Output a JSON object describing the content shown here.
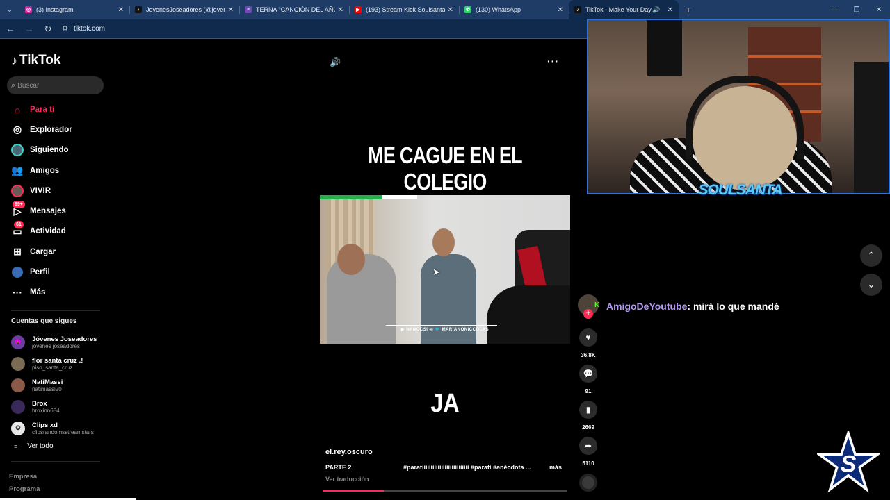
{
  "browser": {
    "tabs": [
      {
        "title": "(3) Instagram",
        "icon": "instagram-icon",
        "color": "#d6249f"
      },
      {
        "title": "JovenesJoseadores (@jovenesjo",
        "icon": "tiktok-icon",
        "color": "#111111"
      },
      {
        "title": "TERNA \"CANCIÓN DEL AÑO\"",
        "icon": "forms-icon",
        "color": "#7248b9"
      },
      {
        "title": "(193) Stream Kick Soulsanta 20",
        "icon": "youtube-icon",
        "color": "#ff0000"
      },
      {
        "title": "(130) WhatsApp",
        "icon": "whatsapp-icon",
        "color": "#25d366"
      },
      {
        "title": "TikTok - Make Your Day",
        "icon": "tiktok-icon",
        "color": "#111111",
        "active": true
      }
    ],
    "url": "tiktok.com"
  },
  "sidebar": {
    "logo": "TikTok",
    "search_placeholder": "Buscar",
    "menu": [
      {
        "label": "Para ti",
        "icon": "home-icon",
        "active": true
      },
      {
        "label": "Explorador",
        "icon": "compass-icon"
      },
      {
        "label": "Siguiendo",
        "icon": "following-avatar-icon"
      },
      {
        "label": "Amigos",
        "icon": "friends-icon"
      },
      {
        "label": "VIVIR",
        "icon": "live-avatar-icon"
      },
      {
        "label": "Mensajes",
        "icon": "messages-icon",
        "badge": "99+"
      },
      {
        "label": "Actividad",
        "icon": "activity-icon",
        "badge": "61"
      },
      {
        "label": "Cargar",
        "icon": "upload-icon"
      },
      {
        "label": "Perfil",
        "icon": "profile-avatar-icon"
      },
      {
        "label": "Más",
        "icon": "more-icon"
      }
    ],
    "following_header": "Cuentas que sigues",
    "following": [
      {
        "name": "Jóvenes Joseadores",
        "handle": "jóvenes joseadores"
      },
      {
        "name": "flor santa cruz .!",
        "handle": "piso_santa_cruz"
      },
      {
        "name": "NatiMassi",
        "handle": "natimassi20"
      },
      {
        "name": "Brox",
        "handle": "broxinn684"
      },
      {
        "name": "Clips xd",
        "handle": "clipsrandomsstreamstars"
      }
    ],
    "see_all": "Ver todo",
    "footer": [
      "Empresa",
      "Programa"
    ]
  },
  "video": {
    "caption_top": "ME CAGUE EN EL COLEGIO",
    "caption_bottom": "JA",
    "clip_handles": "▶ NANOCSI    ◎ 🐦 MARIANONICCOLAS",
    "author": "el.rey.oscuro",
    "description": "PARTE 2",
    "hashtags": "#paratiiiiiiiiiiiiiiiiiiiiiiiiiii #parati #anécdota ...",
    "more": "más",
    "translate": "Ver traducción",
    "progress": 0.25
  },
  "actions": {
    "likes": "36.8K",
    "comments": "91",
    "saves": "2669",
    "shares": "5110"
  },
  "overlay": {
    "streamer_logo": "SOULSANTA",
    "chat_user": "AmigoDeYoutube",
    "chat_message": ": mirá lo que mandé",
    "chat_badge": "K"
  }
}
